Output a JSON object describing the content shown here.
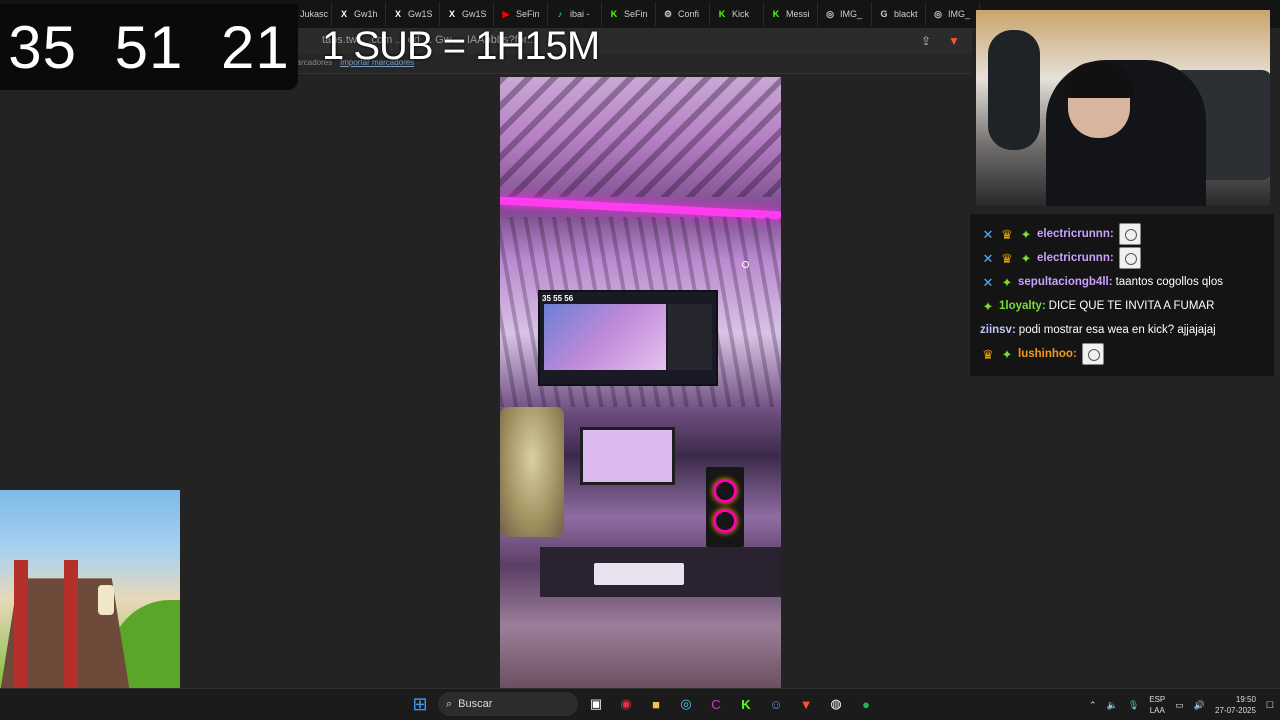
{
  "browser": {
    "tabs": [
      {
        "label": "Jukasc",
        "icon": "x-icon",
        "color": "#ffffff"
      },
      {
        "label": "Gw1h",
        "icon": "x-icon",
        "color": "#ffffff"
      },
      {
        "label": "Gw1S",
        "icon": "x-icon",
        "color": "#ffffff"
      },
      {
        "label": "Gw1S",
        "icon": "x-icon",
        "color": "#ffffff"
      },
      {
        "label": "SeFin",
        "icon": "youtube-icon",
        "color": "#ff0000"
      },
      {
        "label": "ibai -",
        "icon": "tiktok-icon",
        "color": "#00f2ea"
      },
      {
        "label": "SeFin",
        "icon": "kick-icon",
        "color": "#53fc18"
      },
      {
        "label": "Confi",
        "icon": "gear-icon",
        "color": "#cccccc"
      },
      {
        "label": "Kick",
        "icon": "kick-icon",
        "color": "#53fc18"
      },
      {
        "label": "Messi",
        "icon": "kick-icon",
        "color": "#53fc18"
      },
      {
        "label": "IMG_",
        "icon": "globe-icon",
        "color": "#cccccc"
      },
      {
        "label": "blackt",
        "icon": "google-icon",
        "color": "#cccccc"
      },
      {
        "label": "IMG_",
        "icon": "globe-icon",
        "color": "#cccccc"
      }
    ],
    "url_fragment": "tabs.tw... .com ... ed ... Gw ... IAAobbs?for... ",
    "bookmarks_label": "Marcadores",
    "bookmarks_link": "Importar marcadores"
  },
  "overlay": {
    "timer": "35 51 21",
    "sub_rule": "1 SUB = 1H15M"
  },
  "video": {
    "inner_timer": "35 55 56"
  },
  "chat": {
    "messages": [
      {
        "badges": [
          "sword",
          "crown",
          "gem"
        ],
        "user": "electricrunnn:",
        "user_color": "#c9a0ff",
        "text": "",
        "emote": true
      },
      {
        "badges": [
          "sword",
          "crown",
          "gem"
        ],
        "user": "electricrunnn:",
        "user_color": "#c9a0ff",
        "text": "",
        "emote": true
      },
      {
        "badges": [
          "sword",
          "gem"
        ],
        "user": "sepultaciongb4ll:",
        "user_color": "#c9a0ff",
        "text": "taantos cogollos qlos",
        "emote": false
      },
      {
        "badges": [
          "gem"
        ],
        "user": "1loyalty:",
        "user_color": "#7bdb3a",
        "text": "DICE QUE TE INVITA A FUMAR",
        "emote": false
      },
      {
        "badges": [],
        "user": "ziinsv:",
        "user_color": "#c0c4ff",
        "text": "podi mostrar esa wea en kick? ajjajajaj",
        "emote": false
      },
      {
        "badges": [
          "crown",
          "gem"
        ],
        "user": "lushinhoo:",
        "user_color": "#f29a1a",
        "text": "",
        "emote": true
      }
    ]
  },
  "taskbar": {
    "search_placeholder": "Buscar",
    "lang_top": "ESP",
    "lang_bottom": "LAA",
    "time": "19:50",
    "date": "27-07-2025"
  }
}
